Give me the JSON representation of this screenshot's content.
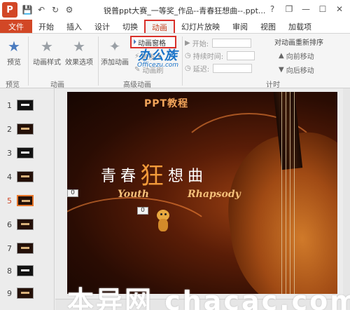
{
  "window": {
    "app_icon_label": "P",
    "title": "锐普ppt大赛_一等奖_作品--青春狂想曲--.ppt...",
    "help": "?",
    "restore": "❐",
    "minimize": "—",
    "maximize": "☐",
    "close": "✕"
  },
  "qat": {
    "save": "💾",
    "undo": "↶",
    "redo": "↻",
    "more": "⚙"
  },
  "tabs": [
    "文件",
    "开始",
    "插入",
    "设计",
    "切换",
    "动画",
    "幻灯片放映",
    "审阅",
    "视图",
    "加载项"
  ],
  "ribbon": {
    "preview_label": "预览",
    "anim_style_label": "动画样式",
    "effect_options_label": "效果选项",
    "add_anim_label": "添加动画",
    "anim_pane_label": "动画窗格",
    "trigger_label": "触发",
    "anim_painter_label": "动画刷",
    "start_label": "开始:",
    "duration_label": "持续时间:",
    "delay_label": "延迟:",
    "reorder_label": "对动画重新排序",
    "move_earlier_label": "向前移动",
    "move_later_label": "向后移动",
    "group_preview": "预览",
    "group_animation": "动画",
    "group_advanced": "高级动画",
    "group_timing": "计时"
  },
  "watermark": {
    "line1": "办公族",
    "line2": "Officezu.com"
  },
  "slides": [
    {
      "num": "1",
      "selected": false
    },
    {
      "num": "2",
      "selected": false
    },
    {
      "num": "3",
      "selected": false
    },
    {
      "num": "4",
      "selected": false
    },
    {
      "num": "5",
      "selected": true
    },
    {
      "num": "6",
      "selected": false
    },
    {
      "num": "7",
      "selected": false
    },
    {
      "num": "8",
      "selected": false
    },
    {
      "num": "9",
      "selected": false
    }
  ],
  "slide_content": {
    "ppt_label": "PPT教程",
    "title_part1": "青春",
    "title_kuang": "狂",
    "title_part2": "想曲",
    "youth": "Youth",
    "rhapsody": "Rhapsody",
    "anim_tag_1": "0",
    "anim_tag_2": "0"
  },
  "bottom_watermark": "本异网  chacac.com",
  "colors": {
    "accent": "#d24726",
    "highlight": "#d9302a"
  }
}
